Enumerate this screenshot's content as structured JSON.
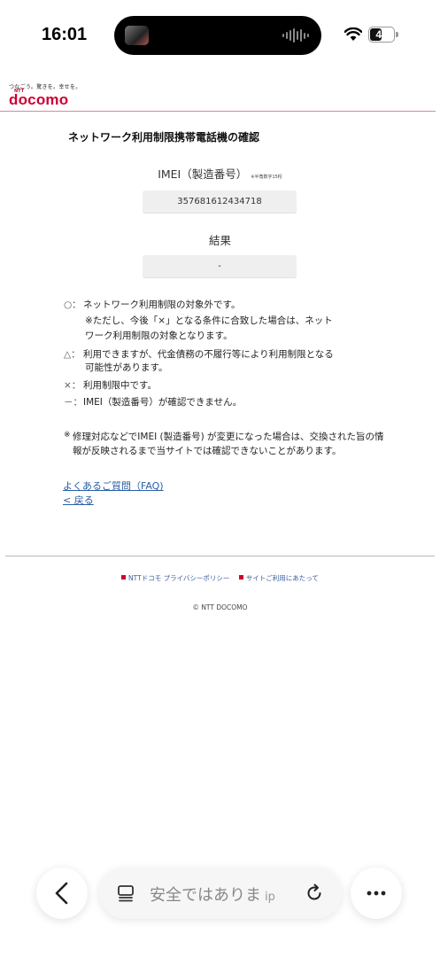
{
  "status_bar": {
    "time": "16:01",
    "battery": "49",
    "battery_level": 0.49
  },
  "header": {
    "tagline": "つなごう。驚きを。幸せを。",
    "logo_ntt": "NTT",
    "logo": "docomo"
  },
  "main": {
    "title": "ネットワーク利用制限携帯電話機の確認",
    "imei_label": "IMEI（製造番号）",
    "imei_note": "※半角数字15桁",
    "imei_value": "357681612434718",
    "result_label": "結果",
    "result_value": "-",
    "legend": [
      {
        "mark": "○：",
        "text": "ネットワーク利用制限の対象外です。"
      },
      {
        "mark": "△：",
        "text": "利用できますが、代金債務の不履行等により利用制限となる"
      },
      {
        "mark": "×：",
        "text": "利用制限中です。"
      },
      {
        "mark": "－：",
        "text": "IMEI（製造番号）が確認できません。"
      }
    ],
    "legend_circle_sub_1": "※ただし、今後「×」となる条件に合致した場合は、ネット",
    "legend_circle_sub_2": "ワーク利用制限の対象となります。",
    "legend_triangle_sub": "可能性があります。",
    "footnote_mark": "※",
    "footnote_text": "修理対応などでIMEI (製造番号) が変更になった場合は、交換された旨の情報が反映されるまで当サイトでは確認できないことがあります。",
    "faq_link": "よくあるご質問（FAQ)",
    "back_link": "< 戻る"
  },
  "footer": {
    "links": [
      "NTTドコモ プライバシーポリシー",
      "サイトご利用にあたって"
    ],
    "copyright": "© NTT DOCOMO"
  },
  "browser_bar": {
    "address_text": "安全ではありま",
    "address_suffix": "ip"
  },
  "colors": {
    "brand": "#cc0033",
    "link": "#2a5ea6"
  }
}
